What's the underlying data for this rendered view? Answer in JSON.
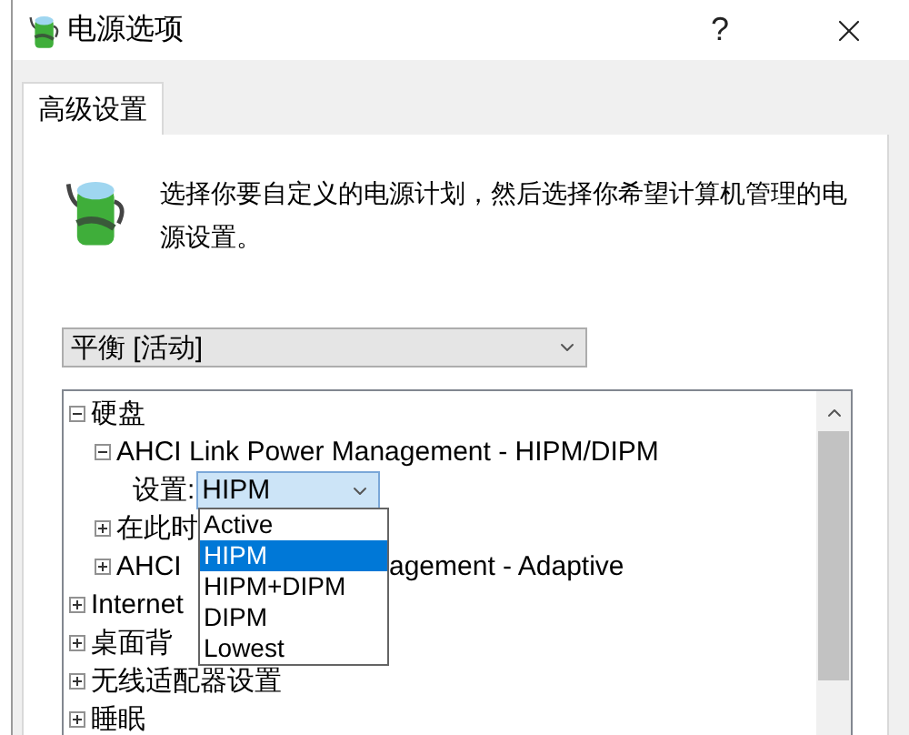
{
  "window": {
    "title": "电源选项",
    "help": "?"
  },
  "tabs": [
    {
      "label": "高级设置",
      "selected": true
    }
  ],
  "description": "选择你要自定义的电源计划，然后选择你希望计算机管理的电源设置。",
  "plan_dropdown": {
    "value": "平衡 [活动]"
  },
  "tree": [
    {
      "label": "硬盘",
      "expanded": true,
      "children": [
        {
          "label": "AHCI Link Power Management - HIPM/DIPM",
          "expanded": true,
          "children": [
            {
              "kind": "setting",
              "label": "设置:",
              "value": "HIPM",
              "open": true,
              "options": [
                {
                  "label": "Active",
                  "selected": false
                },
                {
                  "label": "HIPM",
                  "selected": true
                },
                {
                  "label": "HIPM+DIPM",
                  "selected": false
                },
                {
                  "label": "DIPM",
                  "selected": false
                },
                {
                  "label": "Lowest",
                  "selected": false
                }
              ]
            }
          ]
        },
        {
          "label": "在此时",
          "expanded": false
        },
        {
          "label": "AHCI",
          "tail": "agement - Adaptive",
          "expanded": false
        }
      ]
    },
    {
      "label": "Internet",
      "expanded": false
    },
    {
      "label": "桌面背",
      "expanded": false
    },
    {
      "label": "无线适配器设置",
      "expanded": false
    },
    {
      "label": "睡眠",
      "expanded": false
    }
  ]
}
